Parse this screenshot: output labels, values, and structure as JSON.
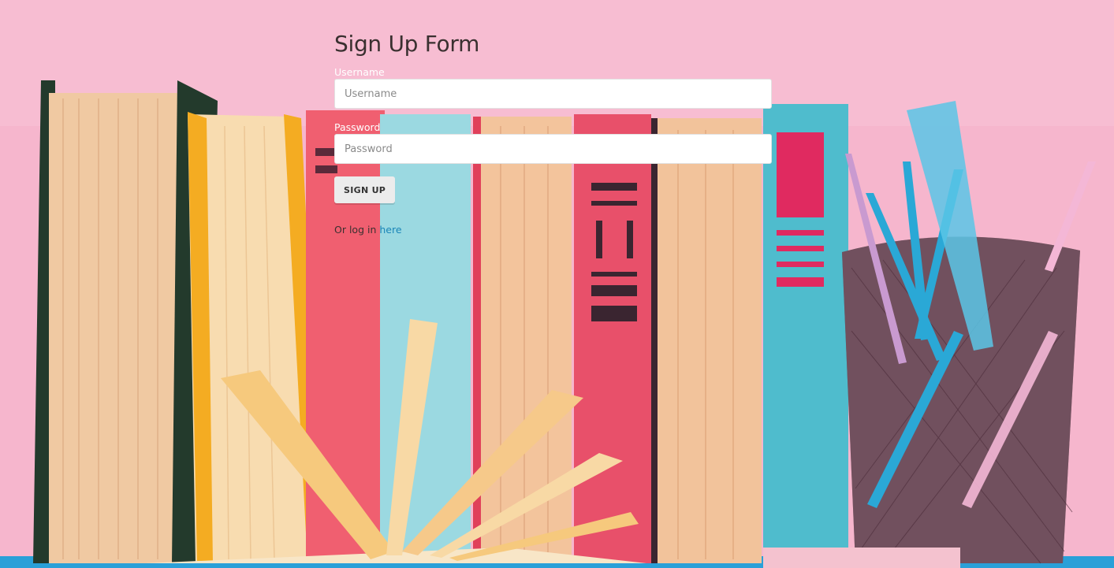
{
  "form": {
    "title": "Sign Up Form",
    "username_label": "Username",
    "username_placeholder": "Username",
    "username_value": "",
    "password_label": "Password",
    "password_placeholder": "Password",
    "password_value": "",
    "submit_label": "SIGN UP",
    "login_prefix": "Or log in ",
    "login_link": "here"
  },
  "colors": {
    "background": "#f5b4cc",
    "link": "#1a86b8",
    "button": "#ececec"
  }
}
